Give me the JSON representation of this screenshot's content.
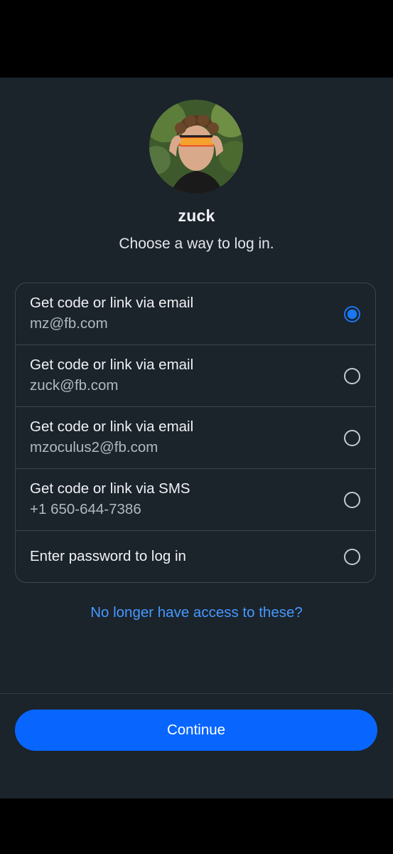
{
  "profile": {
    "username": "zuck",
    "subtitle": "Choose a way to log in."
  },
  "login_options": [
    {
      "title": "Get code or link via email",
      "detail": "mz@fb.com",
      "selected": true
    },
    {
      "title": "Get code or link via email",
      "detail": "zuck@fb.com",
      "selected": false
    },
    {
      "title": "Get code or link via email",
      "detail": "mzoculus2@fb.com",
      "selected": false
    },
    {
      "title": "Get code or link via SMS",
      "detail": "+1 650-644-7386",
      "selected": false
    },
    {
      "title": "Enter password to log in",
      "selected": false
    }
  ],
  "links": {
    "no_access": "No longer have access to these?"
  },
  "actions": {
    "continue_label": "Continue"
  },
  "colors": {
    "background": "#1b232b",
    "accent": "#0866ff",
    "link": "#4599ff",
    "radio_selected": "#1877f2"
  }
}
